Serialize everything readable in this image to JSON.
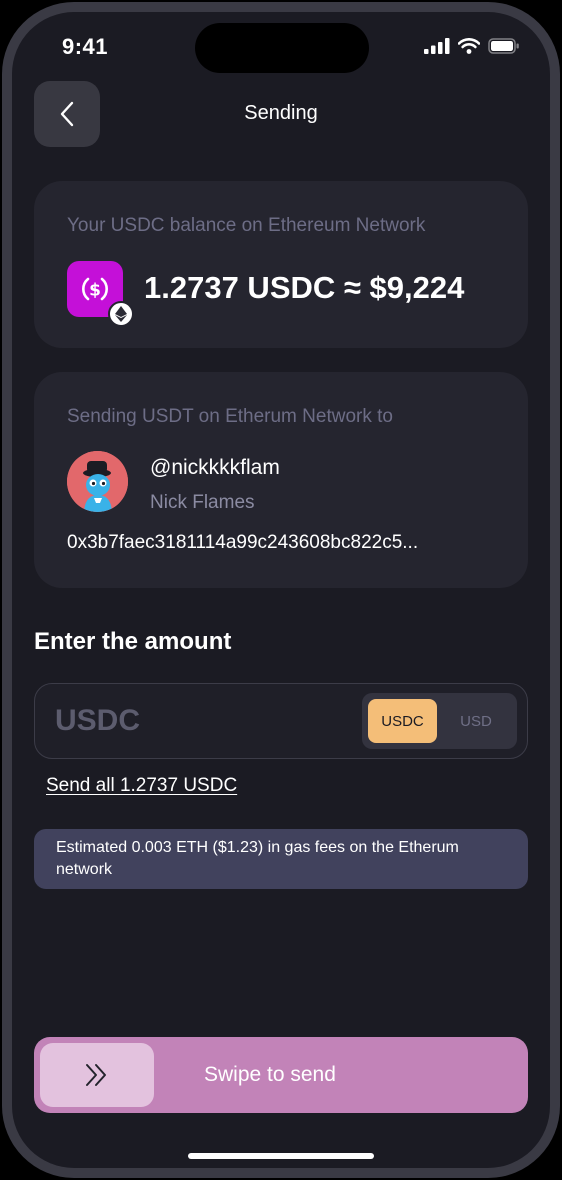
{
  "status_bar": {
    "time": "9:41"
  },
  "header": {
    "title": "Sending"
  },
  "balance_card": {
    "label": "Your USDC balance on Ethereum Network",
    "amount": "1.2737 USDC ≈ $9,224",
    "token_icon": "usdc-icon",
    "network_icon": "ethereum-icon"
  },
  "recipient_card": {
    "label": "Sending USDT on Etherum Network to",
    "handle": "@nickkkkflam",
    "name": "Nick Flames",
    "address": "0x3b7faec3181114a99c243608bc822c5..."
  },
  "amount_section": {
    "title": "Enter the amount",
    "placeholder": "USDC",
    "currency_options": [
      "USDC",
      "USD"
    ],
    "selected_currency": "USDC",
    "send_all_label": "Send all 1.2737 USDC"
  },
  "fee_note": "Estimated 0.003 ETH ($1.23) in gas fees on the Etherum network",
  "swipe": {
    "label": "Swipe to send"
  },
  "colors": {
    "background": "#1b1b23",
    "card": "#25252f",
    "accent_orange": "#f4be78",
    "usdc_brand": "#c410d8",
    "swipe_pink": "#c283b8",
    "fee_banner": "#41425d"
  }
}
